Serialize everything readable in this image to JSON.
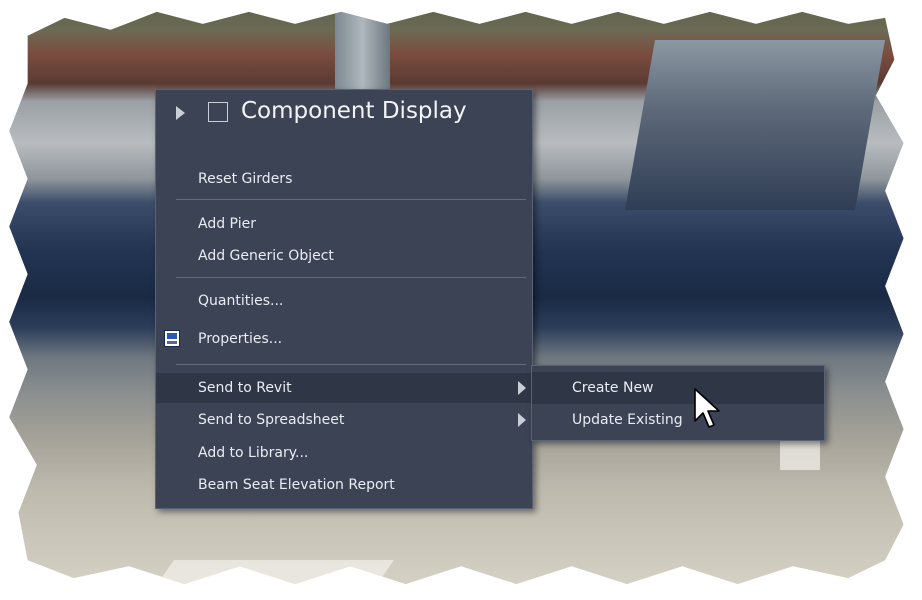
{
  "menu": {
    "header": {
      "title": "Component Display"
    },
    "items": [
      {
        "label": "Reset Girders"
      },
      {
        "label": "Add Pier"
      },
      {
        "label": "Add Generic Object"
      },
      {
        "label": "Quantities..."
      },
      {
        "label": "Properties..."
      },
      {
        "label": "Send to Revit"
      },
      {
        "label": "Send to Spreadsheet"
      },
      {
        "label": "Add to Library..."
      },
      {
        "label": "Beam Seat Elevation Report"
      }
    ]
  },
  "submenu": {
    "items": [
      {
        "label": "Create New"
      },
      {
        "label": "Update Existing"
      }
    ]
  },
  "icons": {
    "properties": "properties-icon",
    "expand": "triangle-right-icon",
    "checkbox": "checkbox-icon",
    "submenu": "submenu-arrow-icon",
    "cursor": "mouse-pointer-icon"
  },
  "colors": {
    "menu_bg": "#3c4354",
    "menu_highlight": "#2f3646",
    "menu_text": "#e9ecf2"
  }
}
